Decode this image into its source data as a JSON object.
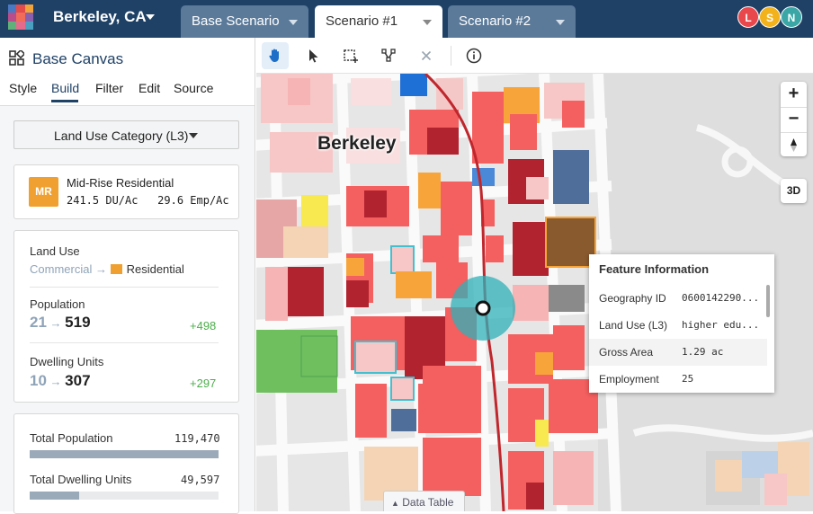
{
  "header": {
    "city": "Berkeley, CA",
    "tabs": [
      {
        "label": "Base Scenario",
        "active": false
      },
      {
        "label": "Scenario #1",
        "active": true
      },
      {
        "label": "Scenario #2",
        "active": false
      }
    ],
    "users": [
      {
        "initial": "L",
        "color": "#e8474c"
      },
      {
        "initial": "S",
        "color": "#f2b21c"
      },
      {
        "initial": "N",
        "color": "#3aa6a6"
      }
    ]
  },
  "sidebar": {
    "title": "Base Canvas",
    "tabs": [
      "Style",
      "Build",
      "Filter",
      "Edit",
      "Source"
    ],
    "active_tab": "Build",
    "category": "Land Use Category (L3)",
    "building_type": {
      "badge": "MR",
      "name": "Mid-Rise Residential",
      "stats": "241.5 DU/Ac   29.6 Emp/Ac"
    },
    "changes": {
      "land_use_label": "Land Use",
      "land_use_from": "Commercial",
      "land_use_to": "Residential",
      "population_label": "Population",
      "population_from": "21",
      "population_to": "519",
      "population_delta": "+498",
      "dwelling_label": "Dwelling Units",
      "dwelling_from": "10",
      "dwelling_to": "307",
      "dwelling_delta": "+297"
    },
    "totals": {
      "population_label": "Total Population",
      "population_value": "119,470",
      "population_fraction": 1.0,
      "dwelling_label": "Total Dwelling Units",
      "dwelling_value": "49,597",
      "dwelling_fraction": 0.26
    }
  },
  "toolbar": {
    "tools": [
      "hand-tool",
      "select-tool",
      "box-select-tool",
      "vertex-tool",
      "clear-tool",
      "info-tool"
    ],
    "active_tool": "hand-tool"
  },
  "map": {
    "place_label": "Berkeley",
    "zoom_in": "+",
    "zoom_out": "−",
    "view_3d": "3D",
    "data_table": "Data Table"
  },
  "feature_info": {
    "title": "Feature Information",
    "rows": [
      {
        "key": "Geography ID",
        "value": "0600142290..."
      },
      {
        "key": "Land Use (L3)",
        "value": "higher edu..."
      },
      {
        "key": "Gross Area",
        "value": "1.29 ac"
      },
      {
        "key": "Employment",
        "value": "25"
      }
    ]
  }
}
